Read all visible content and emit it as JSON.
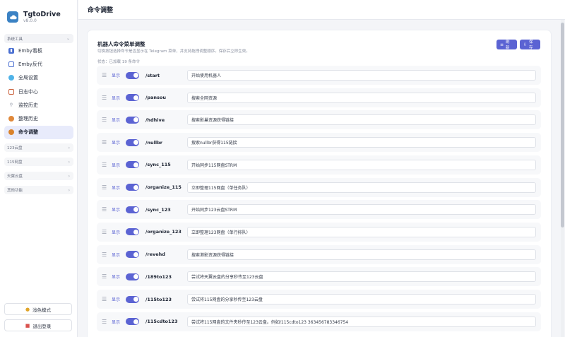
{
  "brand": {
    "name": "TgtoDrive",
    "version": "v8.0.0"
  },
  "sidebar": {
    "group_main": "系统工具",
    "items": [
      {
        "label": "Emby看板",
        "icon": "chart-icon"
      },
      {
        "label": "Emby反代",
        "icon": "server-icon"
      },
      {
        "label": "全局设置",
        "icon": "settings-icon"
      },
      {
        "label": "日志中心",
        "icon": "log-icon"
      },
      {
        "label": "监控历史",
        "icon": "monitor-icon"
      },
      {
        "label": "整理历史",
        "icon": "history-icon"
      },
      {
        "label": "命令调整",
        "icon": "command-icon",
        "active": true
      }
    ],
    "groups": [
      "123云盘",
      "115网盘",
      "天翼云盘",
      "其他功能"
    ],
    "theme_button": "浅色模式",
    "logout_button": "退出登录"
  },
  "header": {
    "title": "命令调整"
  },
  "card": {
    "title": "机器人命令菜单调整",
    "description": "切换按钮选择命令是否显示在 Telegram 菜单，并支持拖拽调整顺序。保存后立即生效。",
    "status": "状态：已加载 19 条命令",
    "refresh_label": "刷新",
    "save_label": "保存"
  },
  "row_show_label": "显示",
  "commands": [
    {
      "cmd": "/start",
      "desc": "开始使用机器人"
    },
    {
      "cmd": "/pansou",
      "desc": "搜索全网资源"
    },
    {
      "cmd": "/hdhive",
      "desc": "搜索影巢资源获得链接"
    },
    {
      "cmd": "/nullbr",
      "desc": "搜索nullbr获得115链接"
    },
    {
      "cmd": "/sync_115",
      "desc": "开始同步115网盘STRM"
    },
    {
      "cmd": "/organize_115",
      "desc": "立即整理115网盘（单任务队）"
    },
    {
      "cmd": "/sync_123",
      "desc": "开始同步123云盘STRM"
    },
    {
      "cmd": "/organize_123",
      "desc": "立即整理123网盘（单行排队）"
    },
    {
      "cmd": "/revehd",
      "desc": "搜索港影资源获得链接"
    },
    {
      "cmd": "/189to123",
      "desc": "尝试将天翼云盘的分享秒传至123云盘"
    },
    {
      "cmd": "/115to123",
      "desc": "尝试将115网盘的分享秒传至123云盘"
    },
    {
      "cmd": "/115cdto123",
      "desc": "尝试将115网盘的文件夹秒传至123云盘。例如/115cdto123 363456783346754"
    }
  ]
}
